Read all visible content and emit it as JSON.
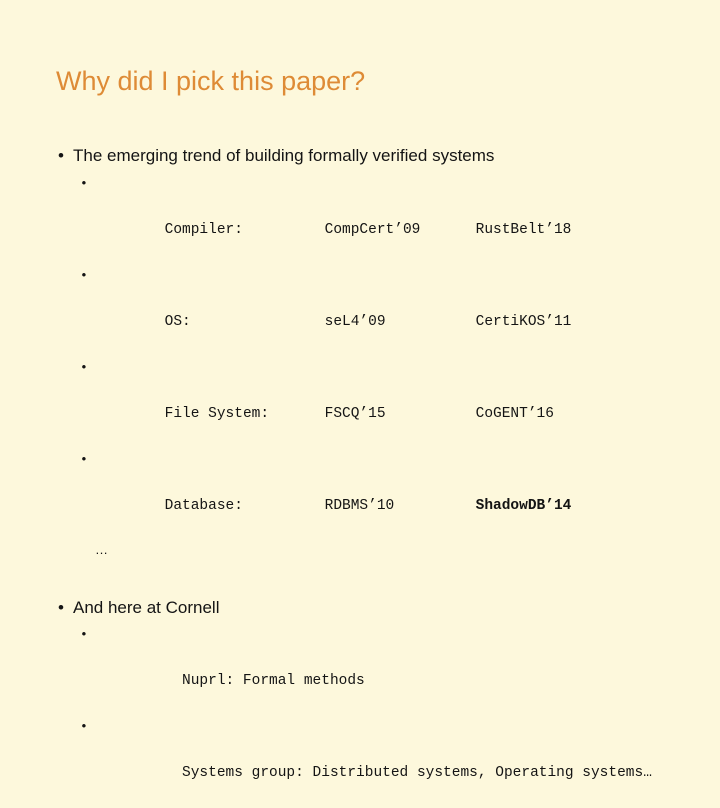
{
  "slide": {
    "title": "Why did I pick this paper?",
    "title_color": "#DE8B36",
    "background_color": "#FDF8DC",
    "text_color": "#141414",
    "bullet_glyph": "•",
    "sub_bullet_glyph": "•",
    "ellipsis": "…"
  },
  "section_systems": {
    "heading": "The emerging trend of building formally verified systems",
    "rows": [
      {
        "label": "Compiler:",
        "middle": "CompCert’09",
        "right": "RustBelt’18",
        "right_bold": false
      },
      {
        "label": "OS:",
        "middle": "seL4’09",
        "right": "CertiKOS’11",
        "right_bold": false
      },
      {
        "label": "File System:",
        "middle": "FSCQ’15",
        "right": "CoGENT’16",
        "right_bold": false
      },
      {
        "label": "Database:",
        "middle": "RDBMS’10",
        "right": "ShadowDB’14",
        "right_bold": true
      }
    ],
    "more_indicator": "…"
  },
  "section_cornell": {
    "heading": "And here at Cornell",
    "items": [
      "Nuprl: Formal methods",
      "Systems group: Distributed systems, Operating systems…"
    ]
  }
}
